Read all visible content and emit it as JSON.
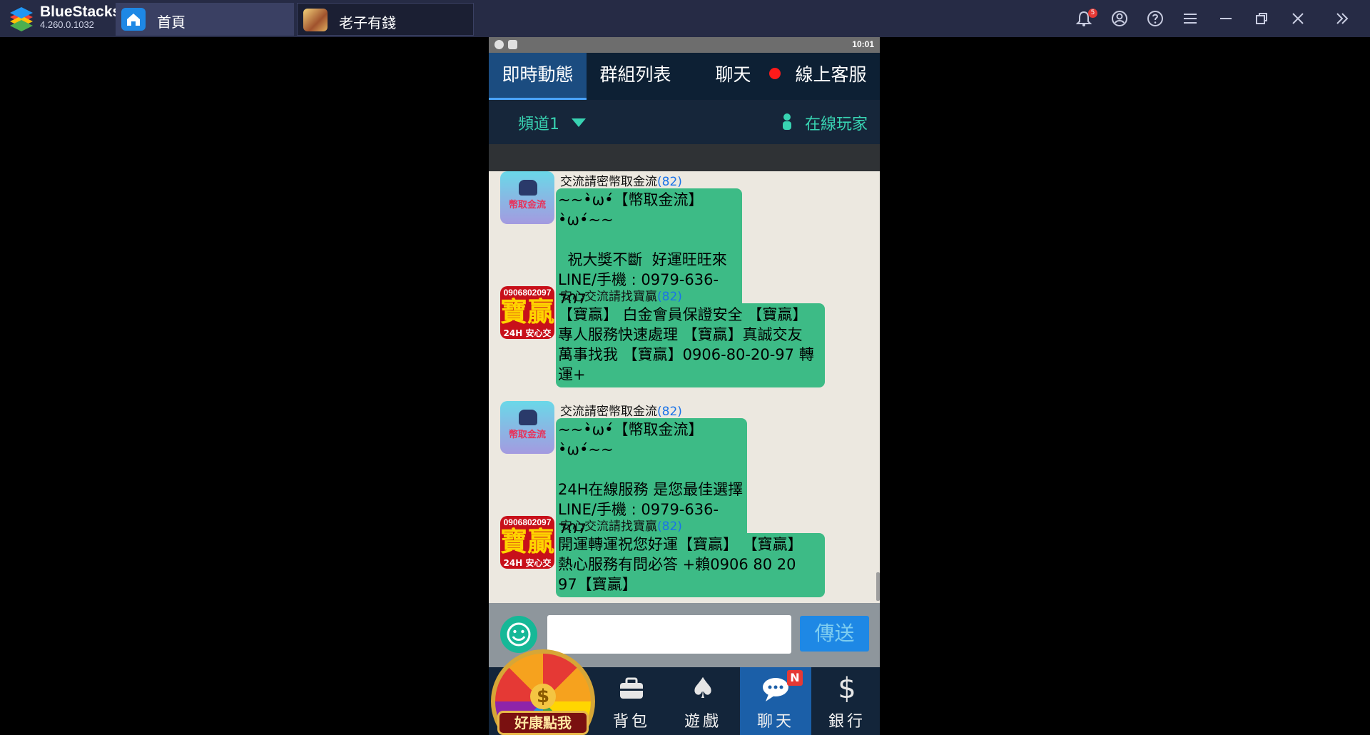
{
  "titlebar": {
    "app_name": "BlueStacks",
    "app_version": "4.260.0.1032",
    "tabs": [
      {
        "label": "首頁"
      },
      {
        "label": "老子有錢"
      }
    ],
    "notification_count": "5",
    "icons": [
      "bell-icon",
      "account-icon",
      "help-icon",
      "menu-icon",
      "minimize-icon",
      "restore-icon",
      "close-icon",
      "expand-sidebar-icon"
    ]
  },
  "statusbar": {
    "time": "10:01"
  },
  "top_tabs": [
    "即時動態",
    "群組列表",
    "聊天",
    "線上客服"
  ],
  "channel": {
    "label": "頻道1",
    "online_label": "在線玩家"
  },
  "messages": [
    {
      "sender": "交流請密幣取金流",
      "count": "(82)",
      "avatar_text": "幣取金流",
      "text": "~~•̀ω•́【幣取金流】•̀ω•́~~\n\n  祝大獎不斷  好運旺旺來\nLINE/手機 : 0979-636-707"
    },
    {
      "sender": "安心交流請找寶贏",
      "count": "(82)",
      "avatar_phone": "0906802097",
      "avatar_big": "寶贏",
      "avatar_sub": "24H 安心交流",
      "text": "【寶贏】 白金會員保證安全 【寶贏】\n專人服務快速處理 【寶贏】真誠交友\n萬事找我 【寶贏】0906-80-20-97 轉\n運+"
    },
    {
      "sender": "交流請密幣取金流",
      "count": "(82)",
      "avatar_text": "幣取金流",
      "text": "~~•̀ω•́【幣取金流】•̀ω•́~~\n\n24H在線服務 是您最佳選擇\nLINE/手機 : 0979-636-707"
    },
    {
      "sender": "安心交流請找寶贏",
      "count": "(82)",
      "avatar_phone": "0906802097",
      "avatar_big": "寶贏",
      "avatar_sub": "24H 安心交流",
      "text": "開運轉運祝您好運【寶贏】 【寶贏】\n熱心服務有問必答 +賴0906 80 20\n97【寶贏】"
    }
  ],
  "input": {
    "value": "",
    "send_label": "傳送"
  },
  "bottom_nav": {
    "wheel_label": "好康點我",
    "items": [
      {
        "label": "背包",
        "icon": "backpack-icon"
      },
      {
        "label": "遊戲",
        "icon": "spade-icon"
      },
      {
        "label": "聊天",
        "icon": "chat-bubble-icon",
        "badge": "N"
      },
      {
        "label": "銀行",
        "icon": "dollar-icon"
      }
    ]
  },
  "colors": {
    "accent": "#3dbb86",
    "brand_teal": "#38d3b2",
    "active_tab": "#1b4c80",
    "send_button": "#1e88e5"
  }
}
